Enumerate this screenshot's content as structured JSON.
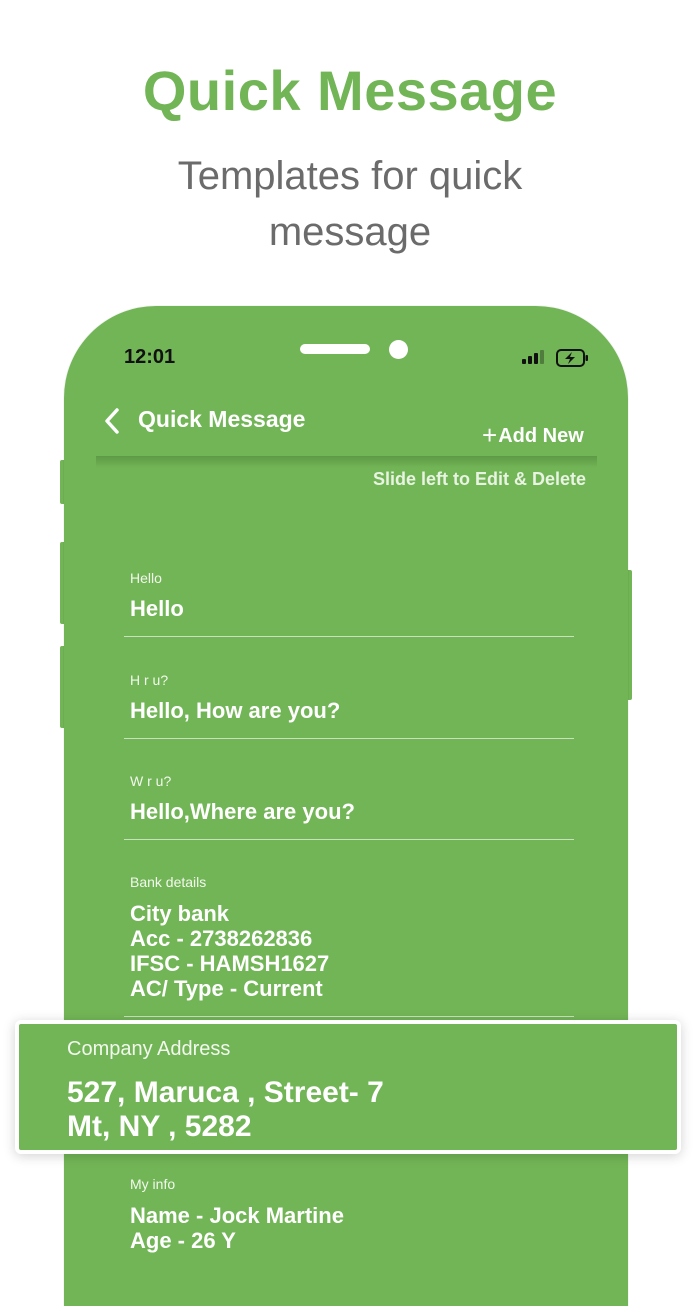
{
  "promo": {
    "headline": "Quick Message",
    "subline": "Templates for quick message"
  },
  "status_bar": {
    "time": "12:01"
  },
  "nav": {
    "title": "Quick Message",
    "add_label": "Add New",
    "add_symbol": "+"
  },
  "hint": "Slide left to Edit & Delete",
  "messages": [
    {
      "title": "Hello",
      "text": "Hello"
    },
    {
      "title": "H r u?",
      "text": "Hello, How are you?"
    },
    {
      "title": "W r u?",
      "text": "Hello,Where are you?"
    },
    {
      "title": "Bank details",
      "text": "City bank\nAcc - 2738262836\nIFSC - HAMSH1627\nAC/ Type - Current"
    },
    {
      "title": "Company Address",
      "text": "527, Maruca , Street- 7\nMt, NY , 5282"
    },
    {
      "title": "My info",
      "text": "Name - Jock Martine\nAge - 26 Y"
    }
  ],
  "colors": {
    "accent": "#72b556",
    "headline": "#72b556",
    "subline": "#6b6b6b",
    "background": "#ffffff"
  },
  "icons": {
    "back": "chevron-left-icon",
    "add": "plus-icon",
    "signal": "cellular-signal-icon",
    "battery": "battery-charging-icon"
  }
}
